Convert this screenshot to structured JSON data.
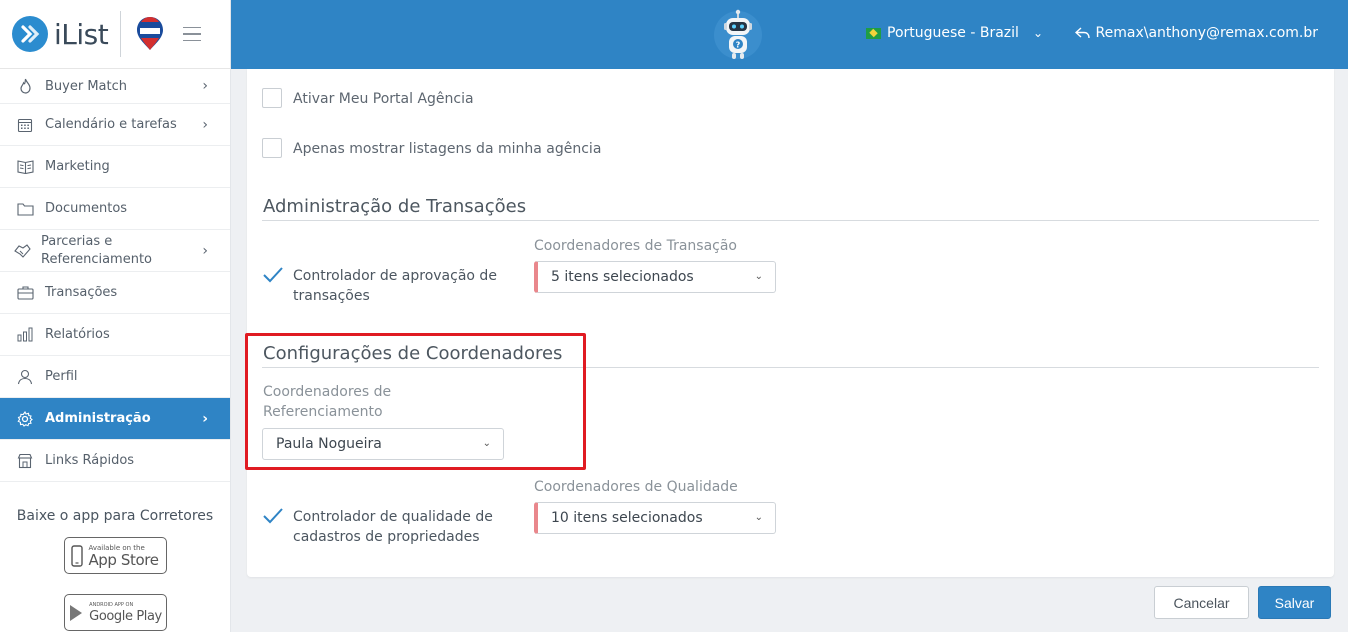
{
  "app": {
    "logo_text": "iList",
    "brand_color": "#2f84c5"
  },
  "sidebar": {
    "items": [
      {
        "label": "Buyer Match",
        "icon": "fire-icon",
        "has_chevron": true
      },
      {
        "label": "Calendário e tarefas",
        "icon": "calendar-icon",
        "has_chevron": true
      },
      {
        "label": "Marketing",
        "icon": "book-icon",
        "has_chevron": false
      },
      {
        "label": "Documentos",
        "icon": "folder-icon",
        "has_chevron": false
      },
      {
        "label": "Parcerias e Referenciamento",
        "icon": "handshake-icon",
        "has_chevron": true
      },
      {
        "label": "Transações",
        "icon": "briefcase-icon",
        "has_chevron": false
      },
      {
        "label": "Relatórios",
        "icon": "bar-chart-icon",
        "has_chevron": false
      },
      {
        "label": "Perfil",
        "icon": "user-icon",
        "has_chevron": false
      },
      {
        "label": "Administração",
        "icon": "gear-icon",
        "has_chevron": true,
        "active": true
      },
      {
        "label": "Links Rápidos",
        "icon": "store-icon",
        "has_chevron": false
      }
    ],
    "app_title": "Baixe o app para Corretores",
    "app_store": {
      "small": "Available on the",
      "big": "App Store"
    },
    "google_play": {
      "small": "ANDROID APP ON",
      "big": "Google Play"
    }
  },
  "header": {
    "language": "Portuguese - Brazil",
    "user": "Remax\\anthony@remax.com.br"
  },
  "form": {
    "checkbox_portal": "Ativar Meu Portal Agência",
    "checkbox_listings": "Apenas mostrar listagens da minha agência",
    "transactions_section": {
      "title": "Administração de Transações",
      "approval_checkbox": "Controlador de aprovação de transações",
      "coordinators_label": "Coordenadores de Transação",
      "coordinators_value": "5 itens selecionados"
    },
    "coordinators_section": {
      "title": "Configurações de Coordenadores",
      "referral_label": "Coordenadores de Referenciamento",
      "referral_value": "Paula Nogueira"
    },
    "quality": {
      "checkbox": "Controlador de qualidade de cadastros de propriedades",
      "coordinators_label": "Coordenadores de Qualidade",
      "coordinators_value": "10 itens selecionados"
    }
  },
  "buttons": {
    "cancel": "Cancelar",
    "save": "Salvar"
  },
  "colors": {
    "highlight": "#e01b22",
    "required_marker": "#e9878c",
    "header_bg": "#2f84c5"
  }
}
